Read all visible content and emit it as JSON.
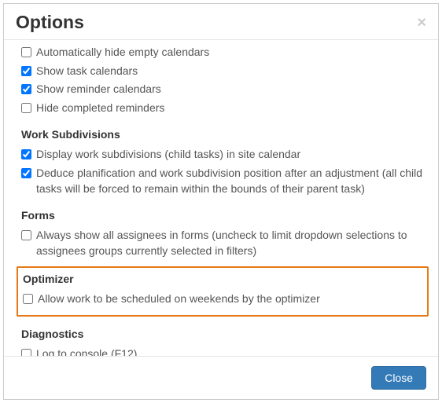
{
  "modal": {
    "title": "Options",
    "close_button": "Close"
  },
  "options": {
    "calendars": [
      {
        "label": "Automatically hide empty calendars",
        "checked": false
      },
      {
        "label": "Show task calendars",
        "checked": true
      },
      {
        "label": "Show reminder calendars",
        "checked": true
      },
      {
        "label": "Hide completed reminders",
        "checked": false
      }
    ],
    "work_subdivisions_heading": "Work Subdivisions",
    "work_subdivisions": [
      {
        "label": "Display work subdivisions (child tasks) in site calendar",
        "checked": true
      },
      {
        "label": "Deduce planification and work subdivision position after an adjustment (all child tasks will be forced to remain within the bounds of their parent task)",
        "checked": true
      }
    ],
    "forms_heading": "Forms",
    "forms": [
      {
        "label": "Always show all assignees in forms (uncheck to limit dropdown selections to assignees groups currently selected in filters)",
        "checked": false
      }
    ],
    "optimizer_heading": "Optimizer",
    "optimizer": [
      {
        "label": "Allow work to be scheduled on weekends by the optimizer",
        "checked": false
      }
    ],
    "diagnostics_heading": "Diagnostics",
    "diagnostics": [
      {
        "label": "Log to console (F12)",
        "checked": false
      }
    ]
  }
}
